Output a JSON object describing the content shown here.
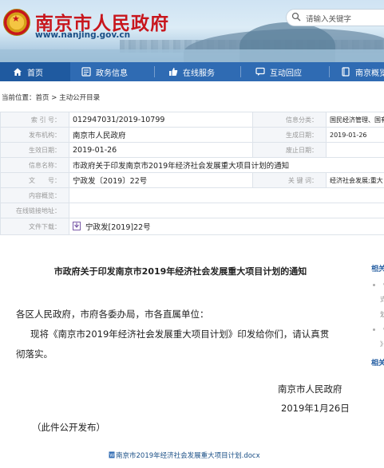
{
  "header": {
    "site_title": "南京市人民政府",
    "site_url": "www.nanjing.gov.cn",
    "search_placeholder": "请输入关键字",
    "brand_red": "#c8161d",
    "nav_blue": "#2f6bb3"
  },
  "nav": {
    "items": [
      {
        "label": "首页",
        "icon": "home-icon"
      },
      {
        "label": "政务信息",
        "icon": "list-icon"
      },
      {
        "label": "在线服务",
        "icon": "thumb-icon"
      },
      {
        "label": "互动回应",
        "icon": "chat-icon"
      },
      {
        "label": "南京概览",
        "icon": "book-icon"
      }
    ]
  },
  "breadcrumb": {
    "prefix": "当前位置：",
    "home": "首页",
    "sep": " > ",
    "current": "主动公开目录"
  },
  "meta": {
    "index_label": "索 引 号：",
    "index_value": "012947031/2019-10799",
    "category_label": "信息分类：",
    "category_value": "国民经济管理、国有",
    "issuer_label": "发布机构：",
    "issuer_value": "南京市人民政府",
    "created_label": "生成日期：",
    "created_value": "2019-01-26",
    "effective_label": "生效日期：",
    "effective_value": "2019-01-26",
    "repeal_label": "废止日期：",
    "repeal_value": "",
    "name_label": "信息名称：",
    "name_value": "市政府关于印发南京市2019年经济社会发展重大项目计划的通知",
    "docno_label": "文　　号：",
    "docno_value": "宁政发〔2019〕22号",
    "keywords_label": "关 键 词：",
    "keywords_value": "经济社会发展;重大",
    "summary_label": "内容概览：",
    "summary_value": "",
    "online_label": "在线链接地址：",
    "online_value": "",
    "download_label": "文件下载：",
    "download_value": "宁政发[2019]22号"
  },
  "article": {
    "title": "市政府关于印发南京市2019年经济社会发展重大项目计划的通知",
    "salutation": "各区人民政府，市府各委办局，市各直属单位：",
    "body_line1": "现将《南京市2019年经济社会发展重大项目计划》印发给你们，请认真贯",
    "body_line2": "彻落实。",
    "signature": "南京市人民政府",
    "date": "2019年1月26日",
    "note": "（此件公开发布）",
    "attachment": "南京市2019年经济社会发展重大项目计划.docx"
  },
  "sidebar": {
    "related_1": "相关",
    "related_2": "相关",
    "frag_1": "《",
    "frag_2": "式",
    "frag_3": "划",
    "frag_4": "《",
    "frag_5": "》"
  }
}
